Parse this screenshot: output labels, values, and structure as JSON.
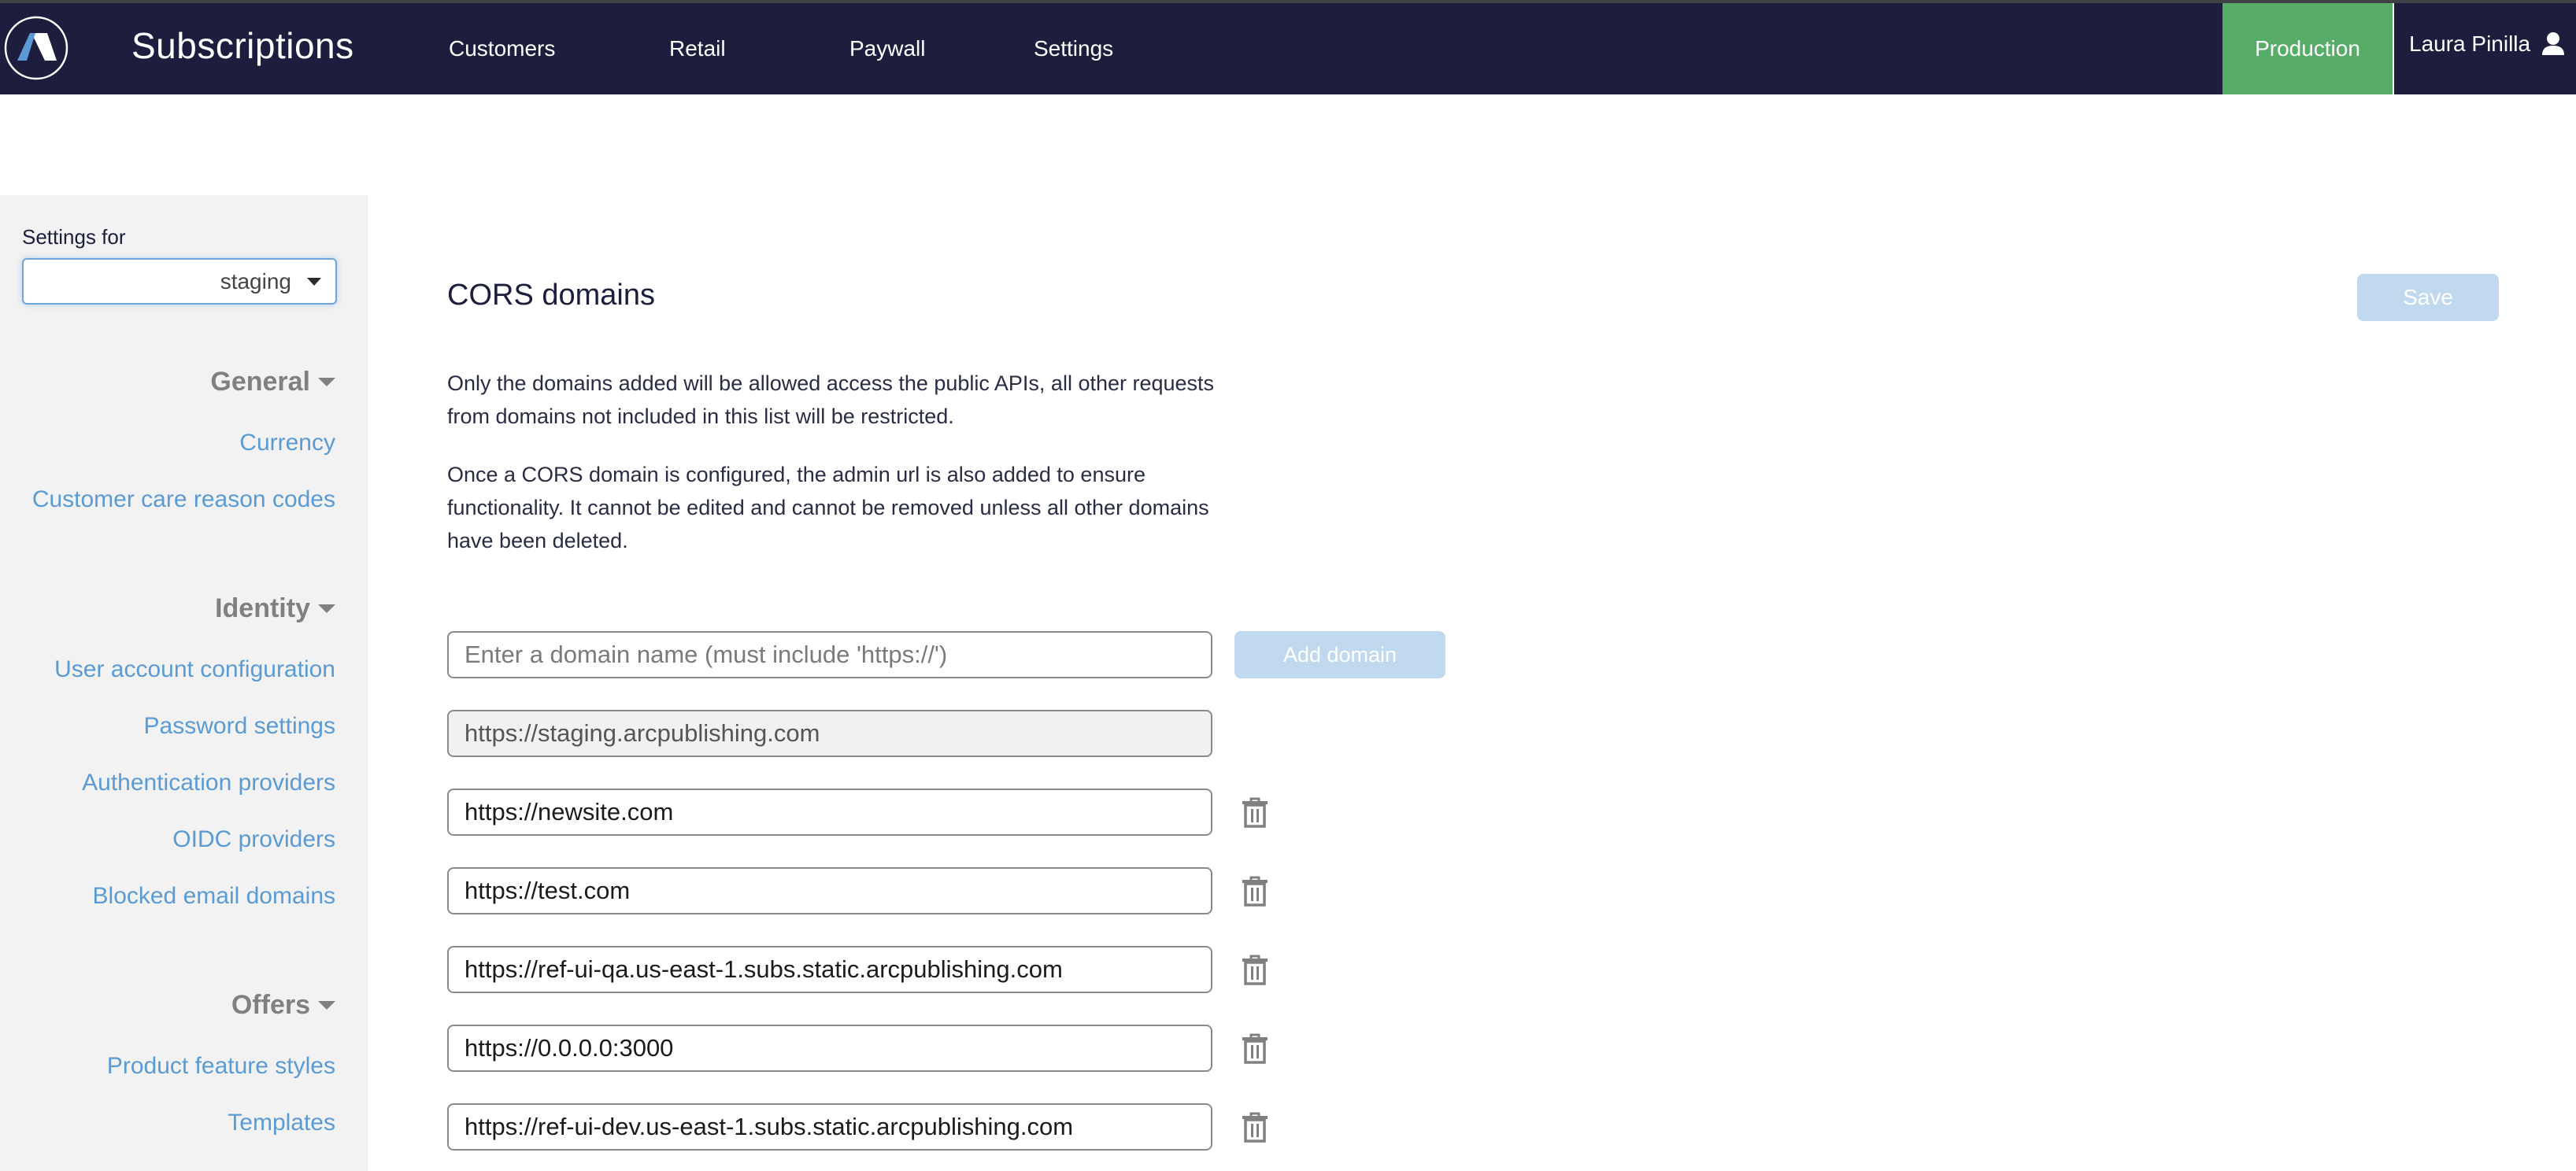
{
  "header": {
    "app_title": "Subscriptions",
    "nav": [
      {
        "label": "Customers"
      },
      {
        "label": "Retail"
      },
      {
        "label": "Paywall"
      },
      {
        "label": "Settings"
      }
    ],
    "environment": "Production",
    "user_name": "Laura Pinilla",
    "logo_icon": "arc-logo-icon",
    "user_icon": "user-icon"
  },
  "colors": {
    "header_bg": "#1d1e3d",
    "environment_bg": "#57ad67",
    "link": "#5b9bd5",
    "button_disabled": "#c0d9ee",
    "sidebar_bg": "#f2f2f2"
  },
  "sidebar": {
    "settings_for_label": "Settings for",
    "settings_for_value": "staging",
    "groups": [
      {
        "label": "General",
        "items": [
          {
            "label": "Currency"
          },
          {
            "label": "Customer care reason codes"
          }
        ]
      },
      {
        "label": "Identity",
        "items": [
          {
            "label": "User account configuration"
          },
          {
            "label": "Password settings"
          },
          {
            "label": "Authentication providers"
          },
          {
            "label": "OIDC providers"
          },
          {
            "label": "Blocked email domains"
          }
        ]
      },
      {
        "label": "Offers",
        "items": [
          {
            "label": "Product feature styles"
          },
          {
            "label": "Templates"
          }
        ]
      }
    ]
  },
  "main": {
    "title": "CORS domains",
    "save_label": "Save",
    "description_1": "Only the domains added will be allowed access the public APIs, all other requests from domains not included in this list will be restricted.",
    "description_2": "Once a CORS domain is configured, the admin url is also added to ensure functionality. It cannot be edited and cannot be removed unless all other domains have been deleted.",
    "new_domain_placeholder": "Enter a domain name (must include 'https://')",
    "new_domain_value": "",
    "add_domain_label": "Add domain",
    "admin_domain": "https://staging.arcpublishing.com",
    "domains": [
      {
        "value": "https://newsite.com"
      },
      {
        "value": "https://test.com"
      },
      {
        "value": "https://ref-ui-qa.us-east-1.subs.static.arcpublishing.com"
      },
      {
        "value": "https://0.0.0.0:3000"
      },
      {
        "value": "https://ref-ui-dev.us-east-1.subs.static.arcpublishing.com"
      }
    ]
  }
}
